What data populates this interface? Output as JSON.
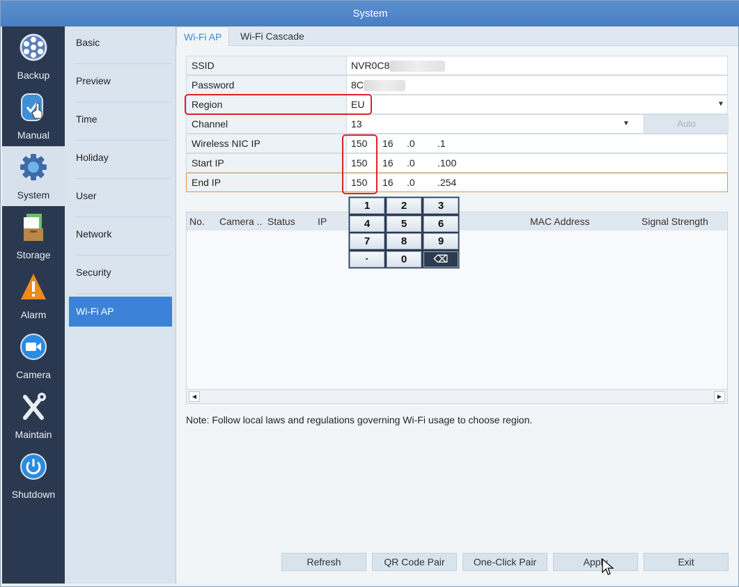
{
  "window": {
    "title": "System"
  },
  "leftnav": [
    {
      "label": "Backup",
      "icon": "backup-reel-icon"
    },
    {
      "label": "Manual",
      "icon": "manual-hand-icon"
    },
    {
      "label": "System",
      "icon": "system-gear-icon",
      "active": true
    },
    {
      "label": "Storage",
      "icon": "storage-icon"
    },
    {
      "label": "Alarm",
      "icon": "alarm-warning-icon"
    },
    {
      "label": "Camera",
      "icon": "camera-icon"
    },
    {
      "label": "Maintain",
      "icon": "maintain-tools-icon"
    },
    {
      "label": "Shutdown",
      "icon": "shutdown-power-icon"
    }
  ],
  "submenu": [
    {
      "label": "Basic"
    },
    {
      "label": "Preview"
    },
    {
      "label": "Time"
    },
    {
      "label": "Holiday"
    },
    {
      "label": "User"
    },
    {
      "label": "Network"
    },
    {
      "label": "Security"
    },
    {
      "label": "Wi-Fi AP",
      "active": true
    }
  ],
  "tabs": [
    {
      "label": "Wi-Fi AP",
      "active": true
    },
    {
      "label": "Wi-Fi Cascade"
    }
  ],
  "form": {
    "ssid": {
      "label": "SSID",
      "value": "NVR0C8"
    },
    "password": {
      "label": "Password",
      "value": "8C"
    },
    "region": {
      "label": "Region",
      "value": "EU"
    },
    "channel": {
      "label": "Channel",
      "value": "13",
      "auto_label": "Auto"
    },
    "wireless_nic_ip": {
      "label": "Wireless NIC IP",
      "octets": [
        "150",
        "16",
        ".0",
        ".1"
      ]
    },
    "start_ip": {
      "label": "Start IP",
      "octets": [
        "150",
        "16",
        ".0",
        ".100"
      ]
    },
    "end_ip": {
      "label": "End IP",
      "octets": [
        "150",
        "16",
        ".0",
        ".254"
      ]
    }
  },
  "keypad": {
    "keys": [
      "1",
      "2",
      "3",
      "4",
      "5",
      "6",
      "7",
      "8",
      "9",
      "·",
      "0",
      "⌫"
    ]
  },
  "table": {
    "columns": [
      "No.",
      "Camera ..",
      "Status",
      "IP",
      "MAC Address",
      "Signal Strength"
    ]
  },
  "note": "Note: Follow local laws and regulations governing Wi-Fi usage to choose region.",
  "buttons": {
    "refresh": "Refresh",
    "qr_code_pair": "QR Code Pair",
    "one_click_pair": "One-Click Pair",
    "apply": "Apply",
    "exit": "Exit"
  }
}
